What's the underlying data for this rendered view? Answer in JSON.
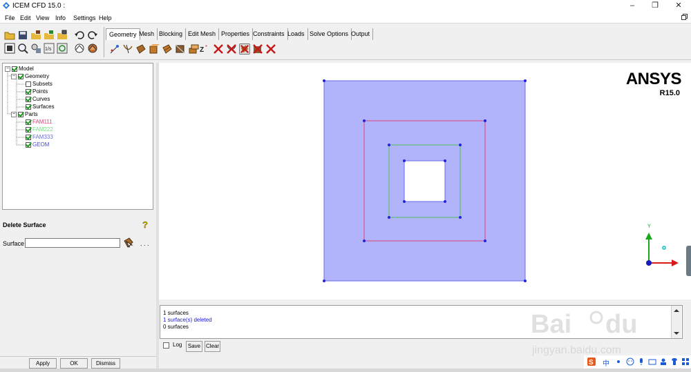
{
  "window": {
    "title": "ICEM CFD 15.0 :",
    "controls": [
      "–",
      "❐",
      "✕"
    ]
  },
  "menu": {
    "items": [
      "File",
      "Edit",
      "View",
      "Info",
      "Settings",
      "Help"
    ],
    "restore_icon": "restore-icon"
  },
  "tabs": [
    "Geometry",
    "Mesh",
    "Blocking",
    "Edit Mesh",
    "Properties",
    "Constraints",
    "Loads",
    "Solve Options",
    "Output"
  ],
  "active_tab": "Geometry",
  "tree": {
    "root": "Model",
    "geometry": "Geometry",
    "geometry_children": [
      "Subsets",
      "Points",
      "Curves",
      "Surfaces"
    ],
    "parts": "Parts",
    "parts_children": [
      {
        "name": "FAM111",
        "color": "#e0407a"
      },
      {
        "name": "FAM222",
        "color": "#6fe07a"
      },
      {
        "name": "FAM333",
        "color": "#6b6be8"
      },
      {
        "name": "GEOM",
        "color": "#4a4ad0"
      }
    ]
  },
  "delete_surface": {
    "title": "Delete Surface",
    "surface_label": "Surface",
    "surface_value": "",
    "dots": ". . ."
  },
  "buttons": {
    "apply": "Apply",
    "ok": "OK",
    "dismiss": "Dismiss"
  },
  "viewport": {
    "brand": "ANSYS",
    "version": "R15.0",
    "axis_y": "Y",
    "colors": {
      "surface": "#b1b3fb",
      "outer_curve": "#6b6be8",
      "fam111_curve": "#e0407a",
      "fam222_curve": "#4ec25a",
      "points": "#2222dd"
    }
  },
  "messages": {
    "lines": [
      {
        "text": "1 surfaces",
        "color": "#000000"
      },
      {
        "text": "1 surface(s) deleted",
        "color": "#1a1ad8"
      },
      {
        "text": "0 surfaces",
        "color": "#000000"
      }
    ],
    "log_label": "Log",
    "save_label": "Save",
    "clear_label": "Clear"
  },
  "tray": {
    "ime": "中",
    "icons": [
      "sogou-icon",
      "punctuation-icon",
      "emoji-icon",
      "mic-icon",
      "keyboard-icon",
      "people-icon",
      "shirt-icon",
      "grid-icon"
    ]
  }
}
